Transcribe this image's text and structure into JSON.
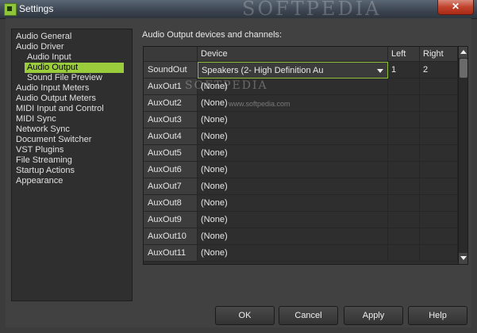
{
  "window": {
    "title": "Settings",
    "close_symbol": "✕",
    "watermark": "SOFTPEDIA"
  },
  "nav": {
    "items": [
      {
        "label": "Audio General",
        "level": 0,
        "selected": false
      },
      {
        "label": "Audio Driver",
        "level": 0,
        "selected": false
      },
      {
        "label": "Audio Input",
        "level": 1,
        "selected": false
      },
      {
        "label": "Audio Output",
        "level": 1,
        "selected": true
      },
      {
        "label": "Sound File Preview",
        "level": 1,
        "selected": false
      },
      {
        "label": "Audio Input Meters",
        "level": 0,
        "selected": false
      },
      {
        "label": "Audio Output Meters",
        "level": 0,
        "selected": false
      },
      {
        "label": "MIDI Input and Control",
        "level": 0,
        "selected": false
      },
      {
        "label": "MIDI Sync",
        "level": 0,
        "selected": false
      },
      {
        "label": "Network Sync",
        "level": 0,
        "selected": false
      },
      {
        "label": "Document Switcher",
        "level": 0,
        "selected": false
      },
      {
        "label": "VST Plugins",
        "level": 0,
        "selected": false
      },
      {
        "label": "File Streaming",
        "level": 0,
        "selected": false
      },
      {
        "label": "Startup Actions",
        "level": 0,
        "selected": false
      },
      {
        "label": "Appearance",
        "level": 0,
        "selected": false
      }
    ]
  },
  "panel": {
    "label": "Audio Output devices and channels:",
    "grid_watermark": "SOFTPEDIA",
    "grid_watermark_url": "www.softpedia.com",
    "columns": {
      "device": "Device",
      "left": "Left",
      "right": "Right"
    },
    "rows": [
      {
        "name": "SoundOut",
        "device": "Speakers (2- High Definition Au",
        "left": "1",
        "right": "2"
      },
      {
        "name": "AuxOut1",
        "device": "(None)",
        "left": "",
        "right": ""
      },
      {
        "name": "AuxOut2",
        "device": "(None)",
        "left": "",
        "right": ""
      },
      {
        "name": "AuxOut3",
        "device": "(None)",
        "left": "",
        "right": ""
      },
      {
        "name": "AuxOut4",
        "device": "(None)",
        "left": "",
        "right": ""
      },
      {
        "name": "AuxOut5",
        "device": "(None)",
        "left": "",
        "right": ""
      },
      {
        "name": "AuxOut6",
        "device": "(None)",
        "left": "",
        "right": ""
      },
      {
        "name": "AuxOut7",
        "device": "(None)",
        "left": "",
        "right": ""
      },
      {
        "name": "AuxOut8",
        "device": "(None)",
        "left": "",
        "right": ""
      },
      {
        "name": "AuxOut9",
        "device": "(None)",
        "left": "",
        "right": ""
      },
      {
        "name": "AuxOut10",
        "device": "(None)",
        "left": "",
        "right": ""
      },
      {
        "name": "AuxOut11",
        "device": "(None)",
        "left": "",
        "right": ""
      }
    ]
  },
  "buttons": {
    "ok": "OK",
    "cancel": "Cancel",
    "apply": "Apply",
    "help": "Help"
  },
  "colors": {
    "accent": "#9bcc3b",
    "background": "#414141"
  }
}
